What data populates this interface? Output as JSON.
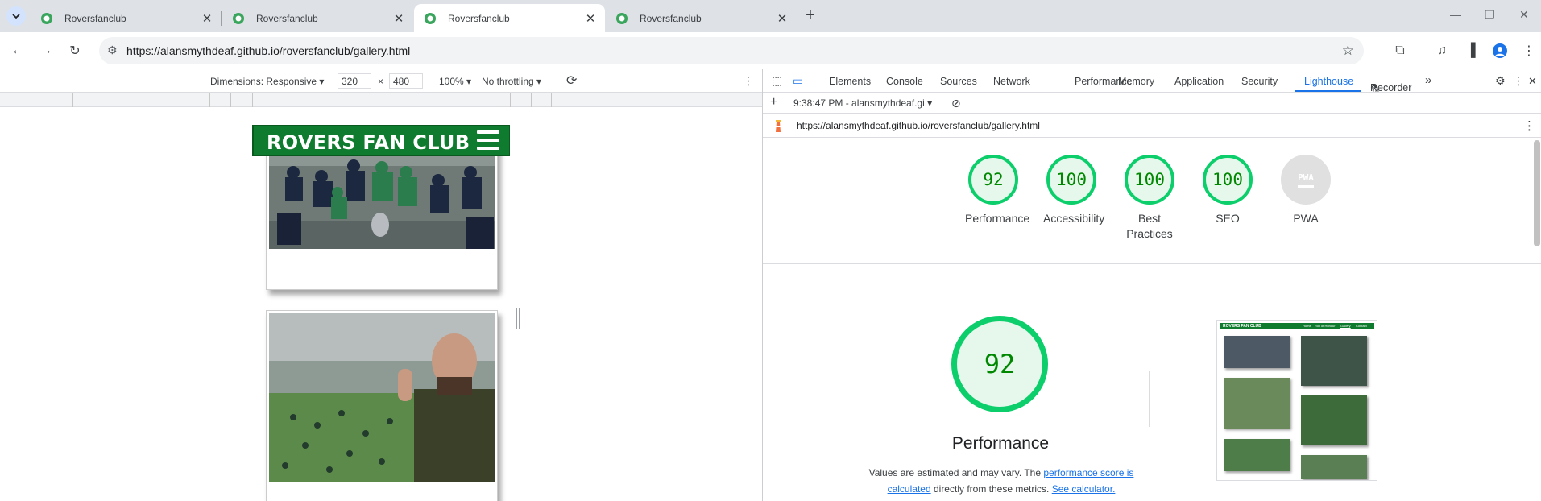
{
  "browser": {
    "tabs": [
      {
        "title": "Roversfanclub",
        "active": false
      },
      {
        "title": "Roversfanclub",
        "active": false
      },
      {
        "title": "Roversfanclub",
        "active": true
      },
      {
        "title": "Roversfanclub",
        "active": false
      }
    ],
    "url": "https://alansmythdeaf.github.io/roversfanclub/gallery.html"
  },
  "device_toolbar": {
    "dimensions_label": "Dimensions: Responsive",
    "width_value": "320",
    "times": "×",
    "height_value": "480",
    "zoom": "100%",
    "throttling": "No throttling"
  },
  "site": {
    "logo_text": "ROVERS FAN CLUB"
  },
  "devtools": {
    "tabs": [
      "Elements",
      "Console",
      "Sources",
      "Network",
      "Performance",
      "Memory",
      "Application",
      "Security",
      "Lighthouse",
      "Recorder"
    ],
    "active_tab": "Lighthouse",
    "more_tabs": "»",
    "report_selector": "9:38:47 PM - alansmythdeaf.gi",
    "audited_url": "https://alansmythdeaf.github.io/roversfanclub/gallery.html"
  },
  "lighthouse": {
    "scores": [
      {
        "value": "92",
        "label": "Performance"
      },
      {
        "value": "100",
        "label": "Accessibility"
      },
      {
        "value": "100",
        "label": "Best Practices"
      },
      {
        "value": "100",
        "label": "SEO"
      }
    ],
    "pwa": {
      "badge": "PWA",
      "label": "PWA"
    },
    "main_score": "92",
    "main_title": "Performance",
    "note_prefix": "Values are estimated and may vary. The ",
    "note_link1": "performance score is calculated",
    "note_mid": " directly from these metrics. ",
    "note_link2": "See calculator.",
    "thumb_logo": "ROVERS FAN CLUB",
    "thumb_nav": [
      "Home",
      "Roll of Honour",
      "Gallery",
      "Contact"
    ]
  },
  "colors": {
    "accent": "#1a73e8",
    "score_good": "#0cce6b",
    "site_green": "#0f7b2e"
  }
}
